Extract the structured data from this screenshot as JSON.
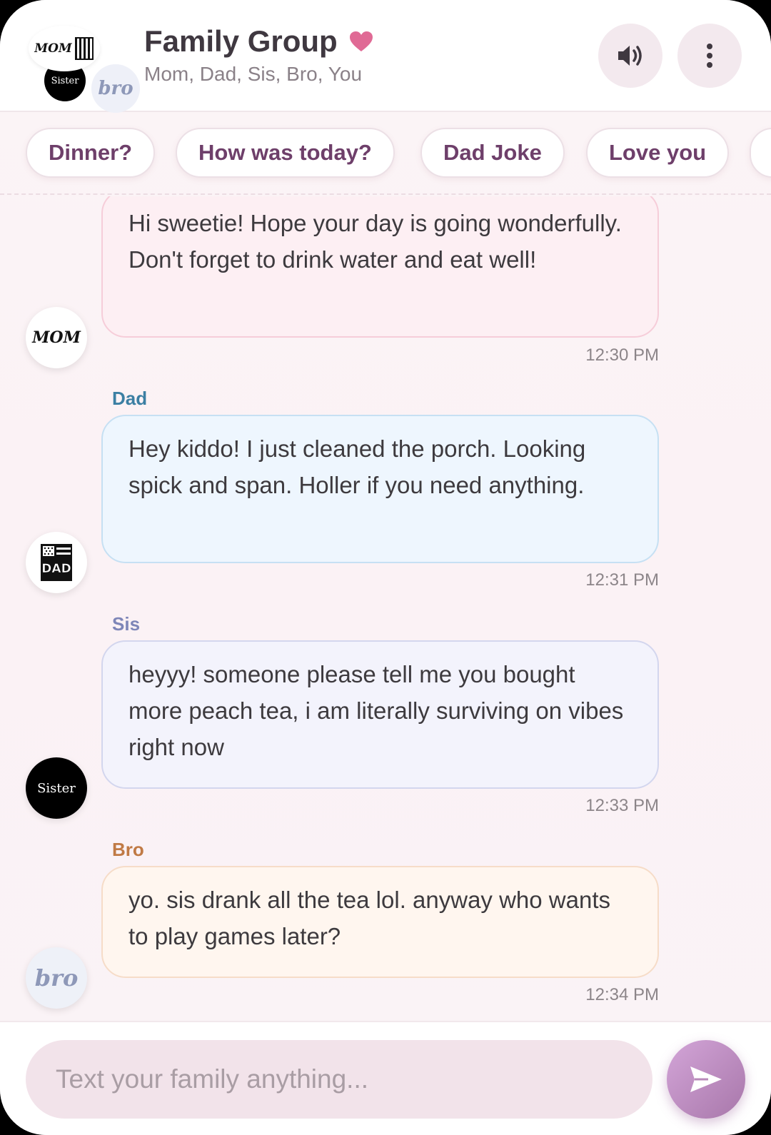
{
  "header": {
    "title": "Family Group",
    "heart_icon": "heart-icon",
    "members": "Mom, Dad, Sis, Bro, You",
    "avatars": {
      "mom": "MOM",
      "sister": "Sister",
      "bro": "bro"
    },
    "sound_icon": "speaker-icon",
    "more_icon": "more-vertical-icon"
  },
  "quick_replies": [
    "Dinner?",
    "How was today?",
    "Dad Joke",
    "Love you"
  ],
  "messages": [
    {
      "sender": "",
      "avatar": "MOM",
      "text": "Hi sweetie! Hope your day is going wonderfully. Don't forget to drink water and eat well!",
      "time": "12:30 PM",
      "bg": "#fdeff3",
      "border": "#f6cdd9"
    },
    {
      "sender": "Dad",
      "avatar": "DAD",
      "text": "Hey kiddo! I just cleaned the porch. Looking spick and span. Holler if you need anything.",
      "time": "12:31 PM",
      "sender_color": "#3b7fa3",
      "bg": "#eef6fe",
      "border": "#c6e0f3"
    },
    {
      "sender": "Sis",
      "avatar": "Sister",
      "text": "heyyy! someone please tell me you bought more peach tea, i am literally surviving on vibes right now",
      "time": "12:33 PM",
      "sender_color": "#7e86b8",
      "bg": "#f3f3fc",
      "border": "#d3d6ee"
    },
    {
      "sender": "Bro",
      "avatar": "bro",
      "text": "yo. sis drank all the tea lol. anyway who wants to play games later?",
      "time": "12:34 PM",
      "sender_color": "#c07a45",
      "bg": "#fff6ef",
      "border": "#f6dcc8"
    }
  ],
  "composer": {
    "placeholder": "Text your family anything...",
    "send_icon": "send-icon"
  },
  "colors": {
    "accent": "#e06a95",
    "send_gradient_start": "#d3a5d8",
    "send_gradient_end": "#a877aa"
  }
}
